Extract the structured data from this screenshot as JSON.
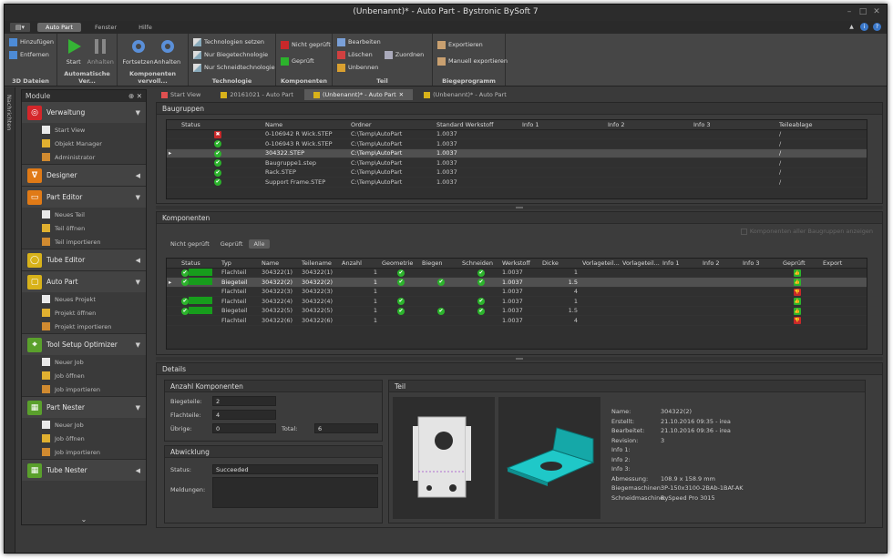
{
  "window": {
    "title": "(Unbenannt)* - Auto Part - Bystronic BySoft 7"
  },
  "apptabs": [
    {
      "label": "Auto Part",
      "active": true
    },
    {
      "label": "Fenster",
      "active": false
    },
    {
      "label": "Hilfe",
      "active": false
    }
  ],
  "ribbon": {
    "g1": {
      "items": [
        "Hinzufügen",
        "Entfernen"
      ],
      "caption": "3D Dateien"
    },
    "g2": {
      "items": [
        "Start",
        "Anhalten"
      ],
      "caption": "Automatische Ver..."
    },
    "g3": {
      "items": [
        "Fortsetzen",
        "Anhalten"
      ],
      "caption": "Komponenten vervoll..."
    },
    "g4": {
      "items": [
        "Technologien setzen",
        "Nur Biegetechnologie",
        "Nur Schneidtechnologie"
      ],
      "caption": "Technologie"
    },
    "g5": {
      "items": [
        "Nicht geprüft",
        "Geprüft"
      ],
      "caption": "Komponenten"
    },
    "g6": {
      "items": [
        "Bearbeiten",
        "Löschen",
        "Unbennen",
        "Zuordnen"
      ],
      "caption": "Teil"
    },
    "g7": {
      "items": [
        "Exportieren",
        "Manuell exportieren"
      ],
      "caption": "Biegeprogramm"
    }
  },
  "sidestrip": {
    "label": "Nachrichten"
  },
  "modules": {
    "title": "Module",
    "sections": [
      {
        "label": "Verwaltung",
        "color": "#d4262a",
        "glyph": "◎",
        "items": [
          "Start View",
          "Objekt Manager",
          "Administrator"
        ]
      },
      {
        "label": "Designer",
        "color": "#e07a16",
        "glyph": "∇",
        "items": []
      },
      {
        "label": "Part Editor",
        "color": "#e07a16",
        "glyph": "▭",
        "items": [
          "Neues Teil",
          "Teil öffnen",
          "Teil importieren"
        ]
      },
      {
        "label": "Tube Editor",
        "color": "#d8b21a",
        "glyph": "◯",
        "items": []
      },
      {
        "label": "Auto Part",
        "color": "#d8b21a",
        "glyph": "▢",
        "items": [
          "Neues Projekt",
          "Projekt öffnen",
          "Projekt importieren"
        ]
      },
      {
        "label": "Tool Setup Optimizer",
        "color": "#5aa02c",
        "glyph": "⌖",
        "items": [
          "Neuer Job",
          "Job öffnen",
          "Job importieren"
        ]
      },
      {
        "label": "Part Nester",
        "color": "#5aa02c",
        "glyph": "▦",
        "items": [
          "Neuer Job",
          "Job öffnen",
          "Job importieren"
        ]
      },
      {
        "label": "Tube Nester",
        "color": "#5aa02c",
        "glyph": "▦",
        "items": []
      }
    ]
  },
  "doctabs": [
    {
      "label": "Start View",
      "active": false
    },
    {
      "label": "20161021 - Auto Part",
      "active": false
    },
    {
      "label": "(Unbenannt)* - Auto Part",
      "active": true
    },
    {
      "label": "(Unbenannt)* - Auto Part",
      "active": false
    }
  ],
  "baugruppen": {
    "title": "Baugruppen",
    "columns": [
      "Status",
      "Name",
      "Ordner",
      "Standard Werkstoff",
      "Info 1",
      "Info 2",
      "Info 3",
      "Teileablage"
    ],
    "rows": [
      {
        "status": "err",
        "name": "0-106942 R Wick.STEP",
        "folder": "C:\\Temp\\AutoPart",
        "mat": "1.0037",
        "ablage": "/"
      },
      {
        "status": "ok",
        "name": "0-106943 R Wick.STEP",
        "folder": "C:\\Temp\\AutoPart",
        "mat": "1.0037",
        "ablage": "/"
      },
      {
        "status": "ok",
        "name": "304322.STEP",
        "folder": "C:\\Temp\\AutoPart",
        "mat": "1.0037",
        "ablage": "/",
        "sel": true
      },
      {
        "status": "ok",
        "name": "Baugruppe1.step",
        "folder": "C:\\Temp\\AutoPart",
        "mat": "1.0037",
        "ablage": "/"
      },
      {
        "status": "ok",
        "name": "Rack.STEP",
        "folder": "C:\\Temp\\AutoPart",
        "mat": "1.0037",
        "ablage": "/"
      },
      {
        "status": "ok",
        "name": "Support Frame.STEP",
        "folder": "C:\\Temp\\AutoPart",
        "mat": "1.0037",
        "ablage": "/"
      }
    ]
  },
  "komponenten": {
    "title": "Komponenten",
    "filters": [
      "Nicht geprüft",
      "Geprüft",
      "Alle"
    ],
    "active_filter": "Alle",
    "checkbox_label": "Komponenten aller Baugruppen anzeigen",
    "columns": [
      "Status",
      "Typ",
      "Name",
      "Teilename",
      "Anzahl",
      "Geometrie",
      "Biegen",
      "Schneiden",
      "Werkstoff",
      "Dicke",
      "Vorlageteil...",
      "Vorlageteil...",
      "Info 1",
      "Info 2",
      "Info 3",
      "Geprüft",
      "Export"
    ],
    "rows": [
      {
        "status": true,
        "typ": "Flachteil",
        "name": "304322(1)",
        "teil": "304322(1)",
        "anz": "1",
        "geo": true,
        "bieg": false,
        "schn": true,
        "wst": "1.0037",
        "dicke": "1",
        "gep": "ok"
      },
      {
        "status": true,
        "typ": "Biegeteil",
        "name": "304322(2)",
        "teil": "304322(2)",
        "anz": "1",
        "geo": true,
        "bieg": true,
        "schn": true,
        "wst": "1.0037",
        "dicke": "1.5",
        "gep": "ok",
        "sel": true
      },
      {
        "status": false,
        "typ": "Flachteil",
        "name": "304322(3)",
        "teil": "304322(3)",
        "anz": "1",
        "geo": false,
        "bieg": false,
        "schn": false,
        "wst": "1.0037",
        "dicke": "4",
        "gep": "err"
      },
      {
        "status": true,
        "typ": "Flachteil",
        "name": "304322(4)",
        "teil": "304322(4)",
        "anz": "1",
        "geo": true,
        "bieg": false,
        "schn": true,
        "wst": "1.0037",
        "dicke": "1",
        "gep": "ok"
      },
      {
        "status": true,
        "typ": "Biegeteil",
        "name": "304322(5)",
        "teil": "304322(5)",
        "anz": "1",
        "geo": true,
        "bieg": true,
        "schn": true,
        "wst": "1.0037",
        "dicke": "1.5",
        "gep": "ok"
      },
      {
        "status": false,
        "typ": "Flachteil",
        "name": "304322(6)",
        "teil": "304322(6)",
        "anz": "1",
        "geo": false,
        "bieg": false,
        "schn": false,
        "wst": "1.0037",
        "dicke": "4",
        "gep": "err"
      }
    ]
  },
  "details": {
    "title": "Details",
    "anzahl": {
      "title": "Anzahl Komponenten",
      "biegeteile_label": "Biegeteile:",
      "biegeteile": "2",
      "flachteile_label": "Flachteile:",
      "flachteile": "4",
      "uebrige_label": "Übrige:",
      "uebrige": "0",
      "total_label": "Total:",
      "total": "6"
    },
    "abwicklung": {
      "title": "Abwicklung",
      "status_label": "Status:",
      "status": "Succeeded",
      "meldungen_label": "Meldungen:"
    },
    "teil": {
      "title": "Teil",
      "info": [
        [
          "Name:",
          "304322(2)"
        ],
        [
          "Erstellt:",
          "21.10.2016 09:35 - irea"
        ],
        [
          "Bearbeitet:",
          "21.10.2016 09:36 - irea"
        ],
        [
          "Revision:",
          "3"
        ],
        [
          "Info 1:",
          ""
        ],
        [
          "Info 2:",
          ""
        ],
        [
          "Info 3:",
          ""
        ],
        [
          "Abmessung:",
          "108.9 x 158.9 mm"
        ],
        [
          "Biegemaschinen:",
          "3P-150x3100-2BAb-1BAf-AK"
        ],
        [
          "Schneidmaschine:",
          "BySpeed Pro 3015"
        ]
      ]
    }
  }
}
